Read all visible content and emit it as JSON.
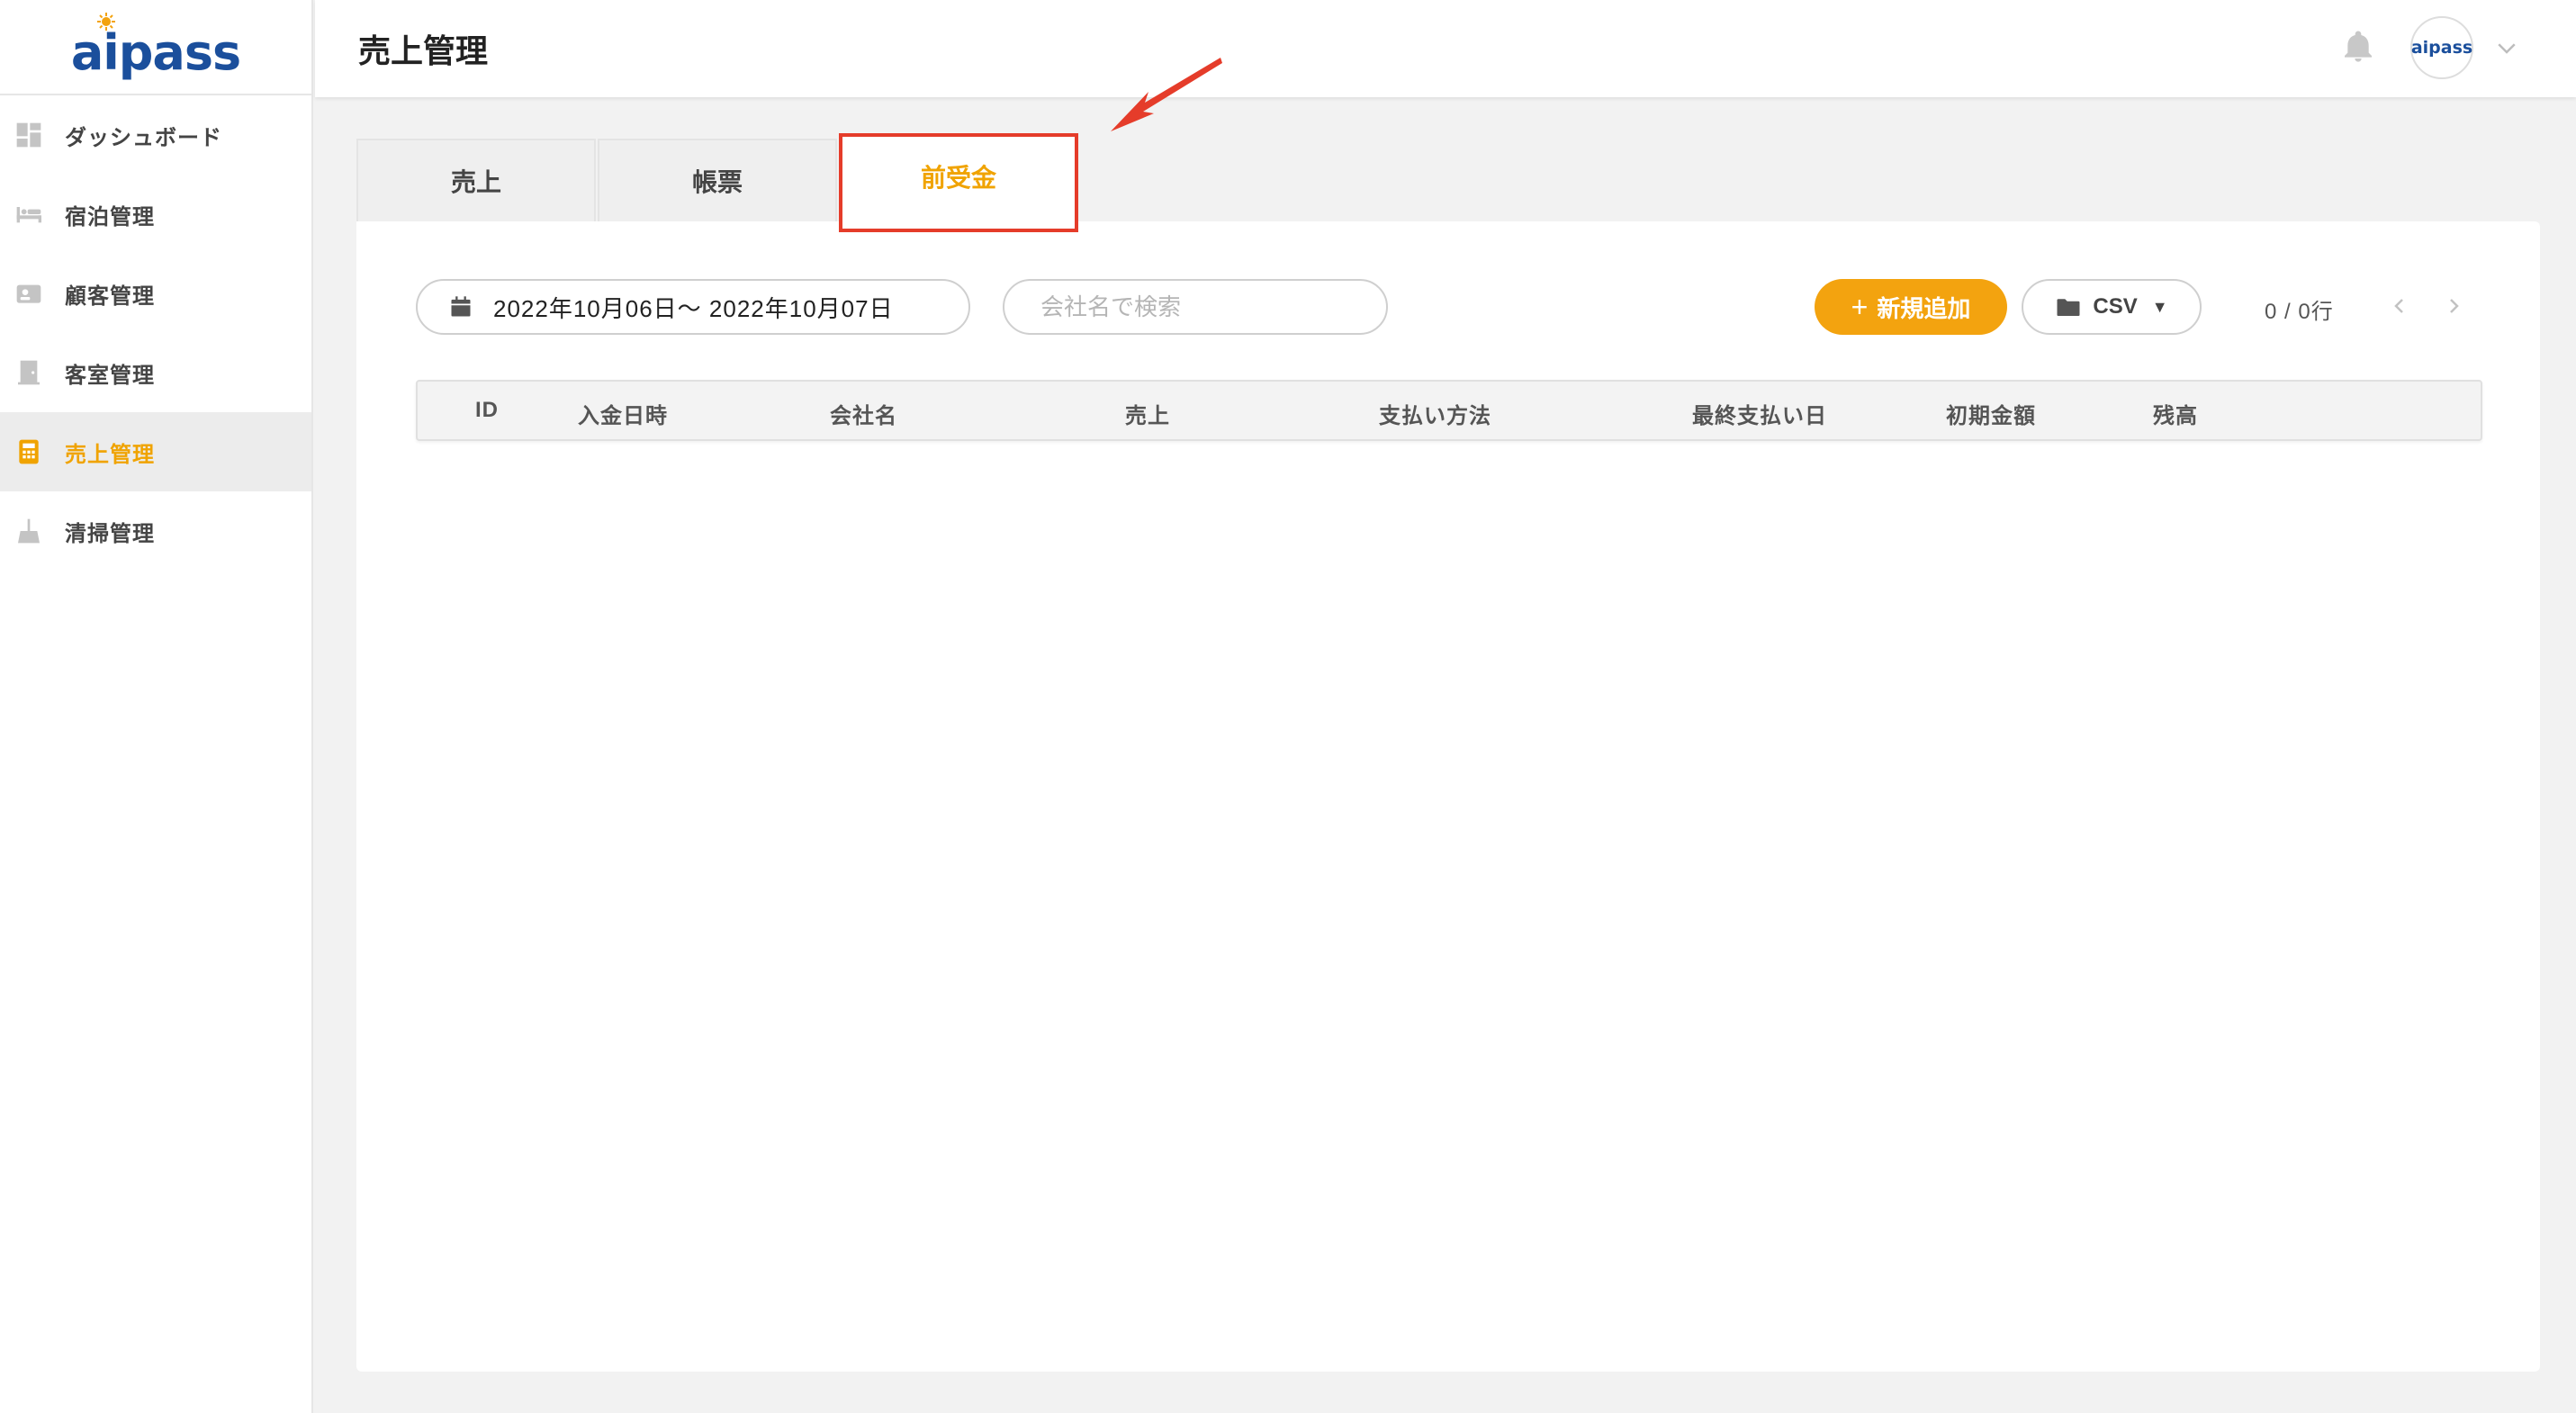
{
  "app": {
    "logo": "aipass",
    "avatar_text": "aipass"
  },
  "header": {
    "title": "売上管理"
  },
  "sidebar": {
    "items": [
      {
        "label": "ダッシュボード",
        "icon": "dashboard-icon"
      },
      {
        "label": "宿泊管理",
        "icon": "bed-icon"
      },
      {
        "label": "顧客管理",
        "icon": "contact-card-icon"
      },
      {
        "label": "客室管理",
        "icon": "door-icon"
      },
      {
        "label": "売上管理",
        "icon": "calculator-icon",
        "active": true
      },
      {
        "label": "清掃管理",
        "icon": "broom-icon"
      }
    ]
  },
  "tabs": [
    {
      "label": "売上"
    },
    {
      "label": "帳票"
    },
    {
      "label": "前受金",
      "active": true
    }
  ],
  "toolbar": {
    "date_range": "2022年10月06日～ 2022年10月07日",
    "search_placeholder": "会社名で検索",
    "add_label": "新規追加",
    "csv_label": "CSV",
    "row_count": "0 / 0行"
  },
  "table": {
    "columns": [
      "ID",
      "入金日時",
      "会社名",
      "売上",
      "支払い方法",
      "最終支払い日",
      "初期金額",
      "残高"
    ],
    "rows": []
  },
  "colors": {
    "accent": "#f3a30f",
    "brand": "#1b4f9c",
    "annotation": "#e53c2a"
  }
}
